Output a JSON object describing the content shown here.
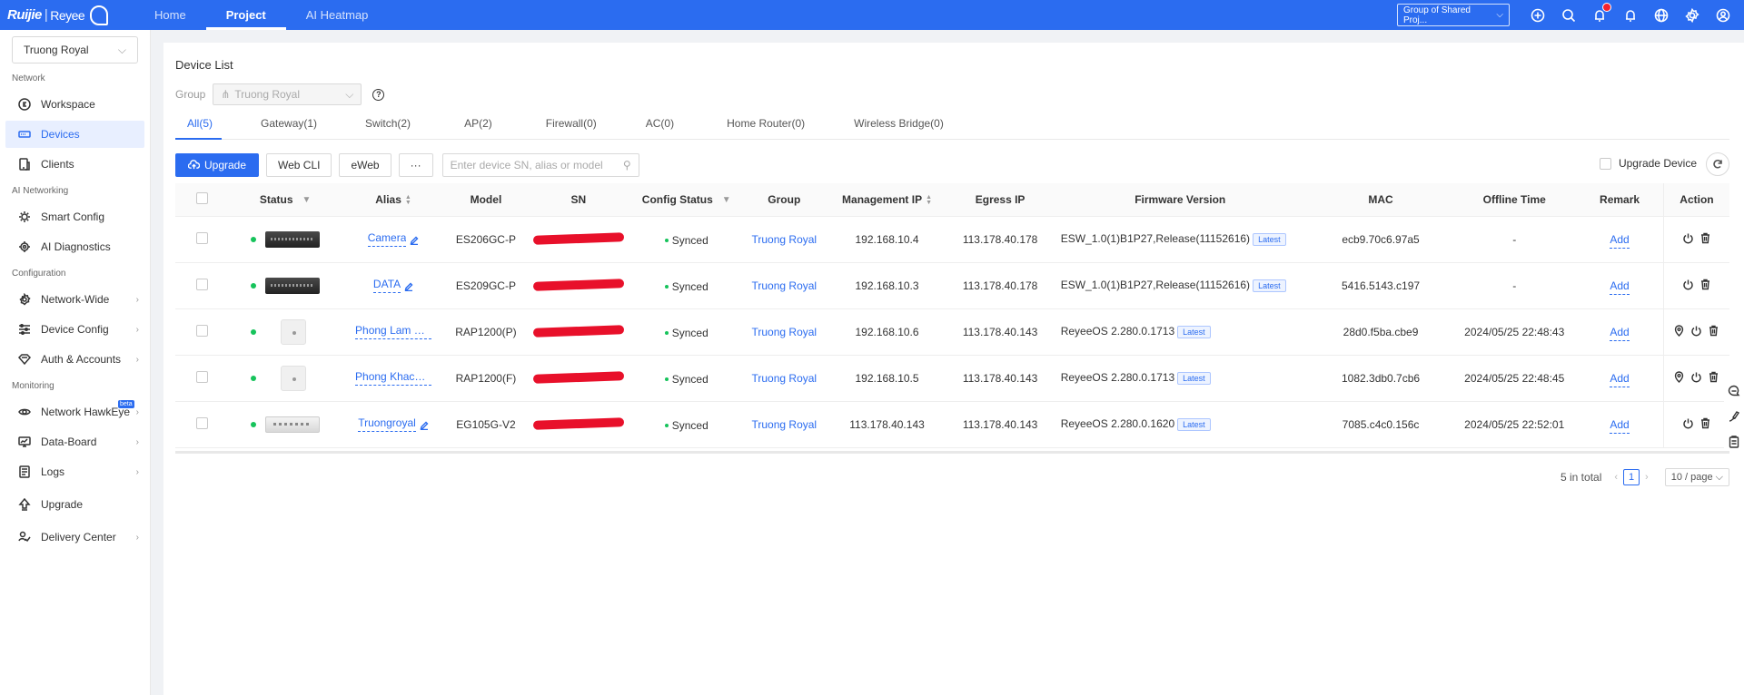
{
  "topbar": {
    "logo_brand": "Ruijie",
    "logo_sub": "Reyee",
    "tabs": [
      {
        "label": "Home"
      },
      {
        "label": "Project"
      },
      {
        "label": "AI Heatmap"
      }
    ],
    "project_selector": "Group of Shared Proj...",
    "icons": [
      "plus-circle-icon",
      "search-icon",
      "notification-icon",
      "bell-icon",
      "globe-icon",
      "gear-icon",
      "user-icon"
    ]
  },
  "sidebar": {
    "project": "Truong Royal",
    "sections": {
      "network": "Network",
      "ai": "AI Networking",
      "config": "Configuration",
      "monitoring": "Monitoring"
    },
    "items": {
      "workspace": "Workspace",
      "devices": "Devices",
      "clients": "Clients",
      "smart_config": "Smart Config",
      "ai_diagnostics": "AI Diagnostics",
      "network_wide": "Network-Wide",
      "device_config": "Device Config",
      "auth_accounts": "Auth & Accounts",
      "network_hawkeye": "Network HawkEye",
      "hawkeye_badge": "beta",
      "data_board": "Data-Board",
      "logs": "Logs",
      "upgrade": "Upgrade",
      "delivery_center": "Delivery Center"
    }
  },
  "main": {
    "title": "Device List",
    "group_label": "Group",
    "group_value": "Truong Royal",
    "tabs": [
      {
        "label": "All(5)"
      },
      {
        "label": "Gateway(1)"
      },
      {
        "label": "Switch(2)"
      },
      {
        "label": "AP(2)"
      },
      {
        "label": "Firewall(0)"
      },
      {
        "label": "AC(0)"
      },
      {
        "label": "Home Router(0)"
      },
      {
        "label": "Wireless Bridge(0)"
      }
    ],
    "toolbar": {
      "upgrade": "Upgrade",
      "web_cli": "Web CLI",
      "eweb": "eWeb",
      "more": "···",
      "search_placeholder": "Enter device SN, alias or model",
      "upgrade_device": "Upgrade Device"
    },
    "columns": [
      "Status",
      "Alias",
      "Model",
      "SN",
      "Config Status",
      "Group",
      "Management IP",
      "Egress IP",
      "Firmware Version",
      "MAC",
      "Offline Time",
      "Remark",
      "Action"
    ],
    "rows": [
      {
        "device": "switch",
        "alias": "Camera",
        "editable": true,
        "model": "ES206GC-P",
        "config": "Synced",
        "group": "Truong Royal",
        "mgmt_ip": "192.168.10.4",
        "egress_ip": "113.178.40.178",
        "firmware": "ESW_1.0(1)B1P27,Release(11152616)",
        "latest": "Latest",
        "mac": "ecb9.70c6.97a5",
        "offline": "-",
        "remark": "Add",
        "location": false
      },
      {
        "device": "switch",
        "alias": "DATA",
        "editable": true,
        "model": "ES209GC-P",
        "config": "Synced",
        "group": "Truong Royal",
        "mgmt_ip": "192.168.10.3",
        "egress_ip": "113.178.40.178",
        "firmware": "ESW_1.0(1)B1P27,Release(11152616)",
        "latest": "Latest",
        "mac": "5416.5143.c197",
        "offline": "-",
        "remark": "Add",
        "location": false
      },
      {
        "device": "ap",
        "alias": "Phong Lam Vi...",
        "editable": false,
        "model": "RAP1200(P)",
        "config": "Synced",
        "group": "Truong Royal",
        "mgmt_ip": "192.168.10.6",
        "egress_ip": "113.178.40.143",
        "firmware": "ReyeeOS 2.280.0.1713",
        "latest": "Latest",
        "mac": "28d0.f5ba.cbe9",
        "offline": "2024/05/25 22:48:43",
        "remark": "Add",
        "location": true
      },
      {
        "device": "ap",
        "alias": "Phong Khach ...",
        "editable": false,
        "model": "RAP1200(F)",
        "config": "Synced",
        "group": "Truong Royal",
        "mgmt_ip": "192.168.10.5",
        "egress_ip": "113.178.40.143",
        "firmware": "ReyeeOS 2.280.0.1713",
        "latest": "Latest",
        "mac": "1082.3db0.7cb6",
        "offline": "2024/05/25 22:48:45",
        "remark": "Add",
        "location": true
      },
      {
        "device": "gateway",
        "alias": "Truongroyal",
        "editable": true,
        "model": "EG105G-V2",
        "config": "Synced",
        "group": "Truong Royal",
        "mgmt_ip": "113.178.40.143",
        "egress_ip": "113.178.40.143",
        "firmware": "ReyeeOS 2.280.0.1620",
        "latest": "Latest",
        "mac": "7085.c4c0.156c",
        "offline": "2024/05/25 22:52:01",
        "remark": "Add",
        "location": false
      }
    ],
    "pager": {
      "total": "5 in total",
      "page": "1",
      "size": "10 / page"
    }
  }
}
